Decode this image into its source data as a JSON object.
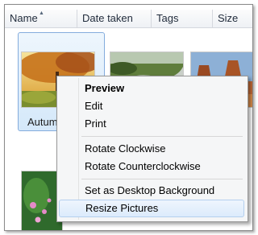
{
  "columns": [
    {
      "label": "Name",
      "sorted": true
    },
    {
      "label": "Date taken"
    },
    {
      "label": "Tags"
    },
    {
      "label": "Size"
    }
  ],
  "selected_item": {
    "caption": "Autumn"
  },
  "context_menu": {
    "items": [
      {
        "label": "Preview",
        "bold": true
      },
      {
        "label": "Edit"
      },
      {
        "label": "Print"
      },
      {
        "label": "Rotate Clockwise"
      },
      {
        "label": "Rotate Counterclockwise"
      },
      {
        "label": "Set as Desktop Background"
      },
      {
        "label": "Resize Pictures",
        "highlighted": true
      }
    ]
  },
  "colors": {
    "selection": "#d4e8fa",
    "menu_bg": "#f5f6f7",
    "highlight": "#dcebfc"
  }
}
